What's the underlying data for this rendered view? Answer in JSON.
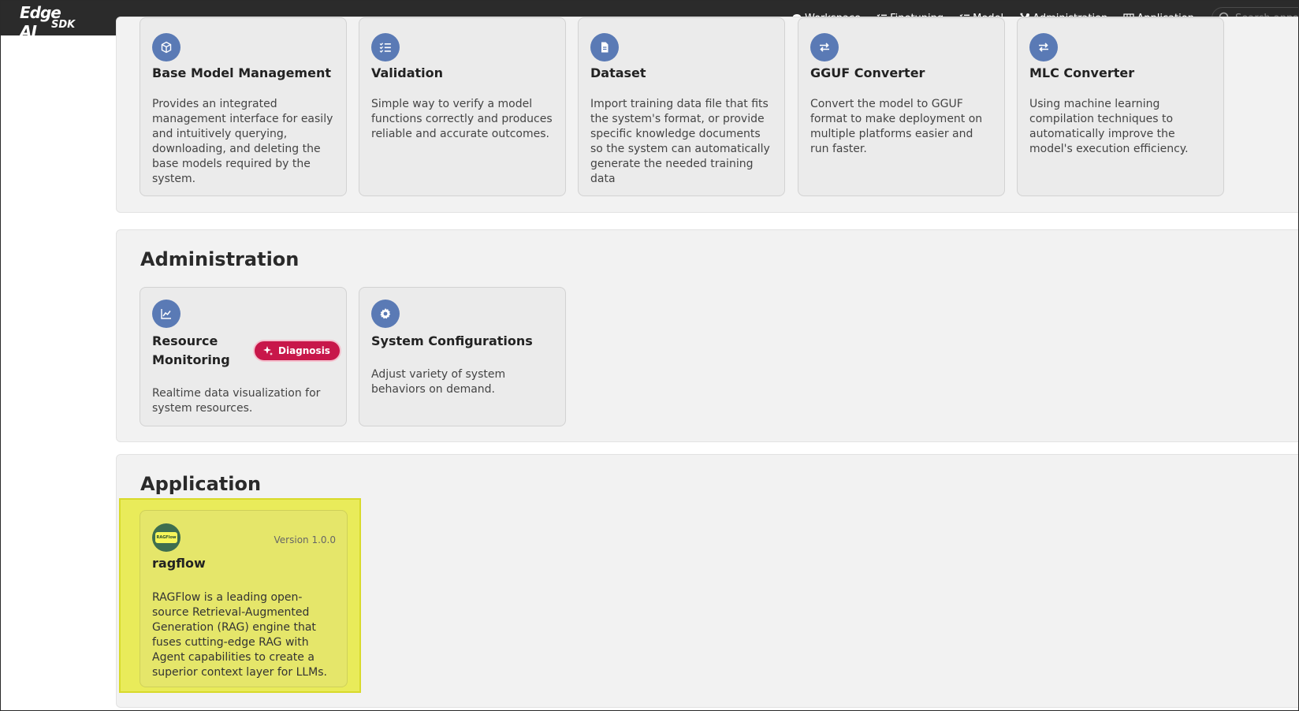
{
  "brand": {
    "line1": "Edge AI",
    "line2": "SDK"
  },
  "nav": {
    "items": [
      {
        "label": "Workspace",
        "icon": "chat-icon"
      },
      {
        "label": "Finetuning",
        "icon": "checklist-icon"
      },
      {
        "label": "Model",
        "icon": "checklist-icon"
      },
      {
        "label": "Administration",
        "icon": "tools-icon"
      },
      {
        "label": "Application",
        "icon": "grid-icon"
      }
    ],
    "search_placeholder": "Search apps"
  },
  "model_section": {
    "cards": [
      {
        "title": "Base Model Management",
        "icon": "cube-icon",
        "desc": "Provides an integrated management interface for easily and intuitively querying, downloading, and deleting the base models required by the system."
      },
      {
        "title": "Validation",
        "icon": "checklist-icon",
        "desc": "Simple way to verify a model functions correctly and produces reliable and accurate outcomes."
      },
      {
        "title": "Dataset",
        "icon": "document-icon",
        "desc": "Import training data file that fits the system's format, or provide specific knowledge documents so the system can automatically generate the needed training data"
      },
      {
        "title": "GGUF Converter",
        "icon": "swap-icon",
        "desc": "Convert the model to GGUF format to make deployment on multiple platforms easier and run faster."
      },
      {
        "title": "MLC Converter",
        "icon": "swap-icon",
        "desc": "Using machine learning compilation techniques to automatically improve the model's execution efficiency."
      }
    ]
  },
  "admin_section": {
    "title": "Administration",
    "cards": [
      {
        "title": "Resource Monitoring",
        "icon": "chart-line-icon",
        "desc": "Realtime data visualization for system resources.",
        "badge": "Diagnosis"
      },
      {
        "title": "System Configurations",
        "icon": "gear-icon",
        "desc": "Adjust variety of system behaviors on demand."
      }
    ]
  },
  "app_section": {
    "title": "Application",
    "apps": [
      {
        "name": "ragflow",
        "version": "Version 1.0.0",
        "logo_text": "RAGFlow",
        "desc": "RAGFlow is a leading open-source Retrieval-Augmented Generation (RAG) engine that fuses cutting-edge RAG with Agent capabilities to create a superior context layer for LLMs."
      }
    ]
  },
  "colors": {
    "topbar": "#2b2b2b",
    "icon_circle": "#5a7ab5",
    "badge": "#c8174a",
    "highlight": "#e9eb5a"
  }
}
